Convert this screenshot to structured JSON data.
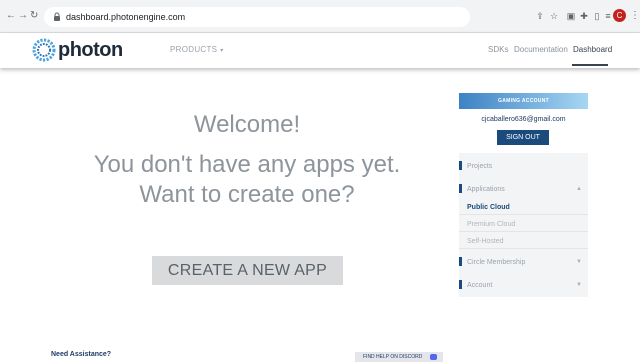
{
  "browser": {
    "back_icon": "←",
    "forward_icon": "→",
    "reload_icon": "↻",
    "url": "dashboard.photonengine.com",
    "avatar_initial": "C",
    "menu_icon": "⋮"
  },
  "header": {
    "logo_text": "photon",
    "products_label": "PRODUCTS",
    "nav": [
      "SDKs",
      "Documentation",
      "Dashboard"
    ]
  },
  "main": {
    "welcome": "Welcome!",
    "no_apps_line1": "You don't have any apps yet.",
    "no_apps_line2": "Want to create one?",
    "create_button": "CREATE A NEW APP"
  },
  "sidebar": {
    "account_header": "GAMING ACCOUNT",
    "email": "cjcaballero636@gmail.com",
    "sign_out": "SIGN OUT",
    "projects": "Projects",
    "applications": "Applications",
    "public_cloud": "Public Cloud",
    "premium_cloud": "Premium Cloud",
    "self_hosted": "Self-Hosted",
    "circle_membership": "Circle Membership",
    "account": "Account"
  },
  "footer": {
    "need_assistance": "Need Assistance?",
    "discord_text": "FIND HELP ON DISCORD"
  },
  "colors": {
    "brand_navy": "#1b4a7d",
    "accent_blue": "#3d82c4",
    "discord": "#5865f2"
  }
}
